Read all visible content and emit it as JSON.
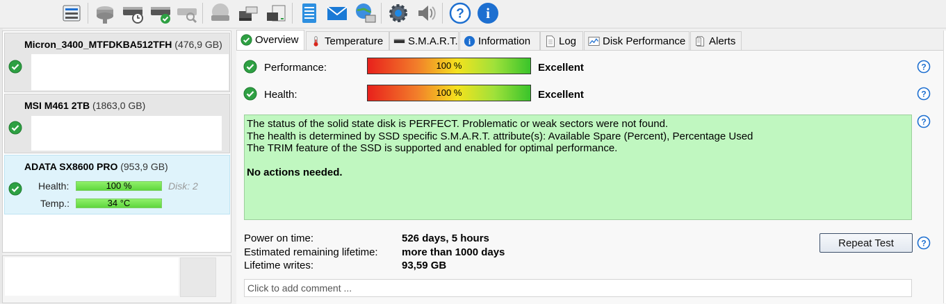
{
  "toolbar": {
    "buttons": [
      {
        "icon": "disk-list-icon"
      },
      {
        "icon": "disk-wrench-icon"
      },
      {
        "icon": "disk-clock-icon"
      },
      {
        "icon": "disk-check-icon"
      },
      {
        "icon": "disk-search-icon"
      },
      {
        "icon": "disk-gray-icon"
      },
      {
        "icon": "disks-stack-icon"
      },
      {
        "icon": "disk-drive-icon"
      },
      {
        "icon": "notepad-icon"
      },
      {
        "icon": "mail-icon"
      },
      {
        "icon": "globe-monitor-icon"
      },
      {
        "icon": "settings-gear-icon"
      },
      {
        "icon": "speaker-icon"
      },
      {
        "icon": "help-icon"
      },
      {
        "icon": "info-icon"
      }
    ]
  },
  "disks": [
    {
      "name": "Micron_3400_MTFDKBA512TFH",
      "size": "(476,9 GB)"
    },
    {
      "name": "MSI M461 2TB",
      "size": "(1863,0 GB)"
    },
    {
      "name": "ADATA SX8600 PRO",
      "size": "(953,9 GB)",
      "health_label": "Health:",
      "health_value": "100 %",
      "disk_label": "Disk: 2",
      "temp_label": "Temp.:",
      "temp_value": "34 °C"
    }
  ],
  "tabs": [
    {
      "label": "Overview",
      "icon": "check-icon"
    },
    {
      "label": "Temperature",
      "icon": "thermometer-icon"
    },
    {
      "label": "S.M.A.R.T.",
      "icon": "drive-icon"
    },
    {
      "label": "Information",
      "icon": "info-icon"
    },
    {
      "label": "Log",
      "icon": "document-icon"
    },
    {
      "label": "Disk Performance",
      "icon": "chart-icon"
    },
    {
      "label": "Alerts",
      "icon": "alerts-icon"
    }
  ],
  "overview": {
    "performance": {
      "label": "Performance:",
      "value": "100 %",
      "rating": "Excellent"
    },
    "health": {
      "label": "Health:",
      "value": "100 %",
      "rating": "Excellent"
    },
    "status_lines": [
      "The status of the solid state disk is PERFECT. Problematic or weak sectors were not found.",
      "The health is determined by SSD specific S.M.A.R.T. attribute(s):  Available Spare (Percent), Percentage Used",
      "The TRIM feature of the SSD is supported and enabled for optimal performance."
    ],
    "status_action": "No actions needed.",
    "info": [
      {
        "label": "Power on time:",
        "value": "526 days, 5 hours"
      },
      {
        "label": "Estimated remaining lifetime:",
        "value": "more than 1000 days"
      },
      {
        "label": "Lifetime writes:",
        "value": "93,59 GB"
      }
    ],
    "repeat_button": "Repeat Test",
    "comment_placeholder": "Click to add comment ..."
  },
  "colors": {
    "status_box": "#c0f7c0",
    "selected_disk": "#dff3fb",
    "check_green": "#2ea043"
  }
}
